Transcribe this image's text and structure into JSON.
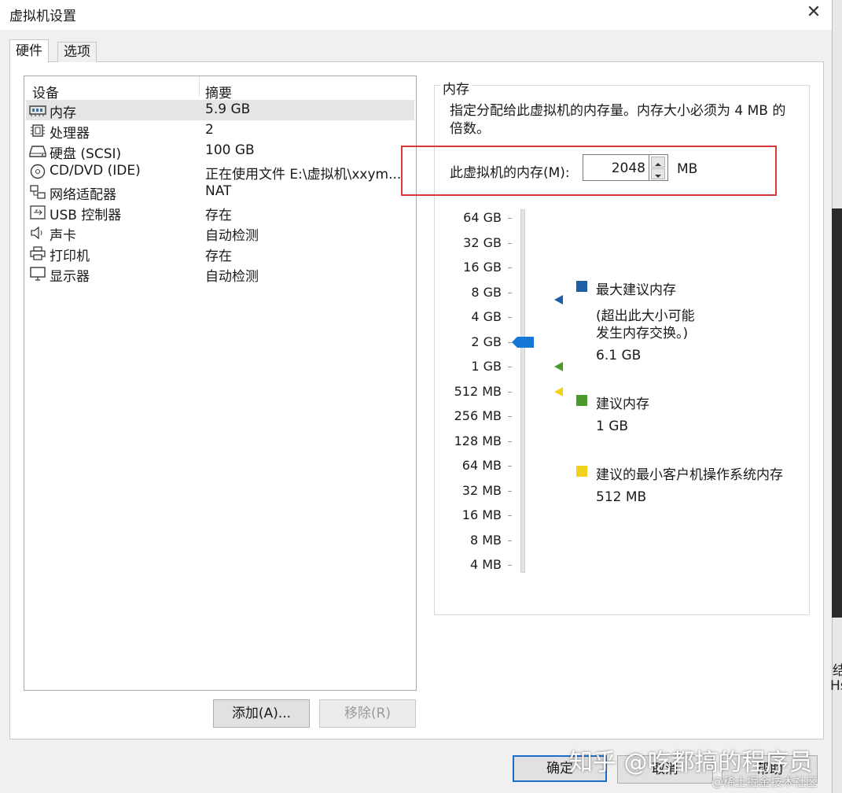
{
  "window": {
    "title": "虚拟机设置",
    "close_glyph": "✕"
  },
  "tabs": [
    {
      "label": "硬件"
    },
    {
      "label": "选项"
    }
  ],
  "device_list": {
    "columns": {
      "device": "设备",
      "summary": "摘要"
    },
    "rows": [
      {
        "name": "内存",
        "summary": "5.9 GB",
        "icon": "memory-icon"
      },
      {
        "name": "处理器",
        "summary": "2",
        "icon": "processor-icon"
      },
      {
        "name": "硬盘 (SCSI)",
        "summary": "100 GB",
        "icon": "hard-disk-icon"
      },
      {
        "name": "CD/DVD (IDE)",
        "summary": "正在使用文件 E:\\虚拟机\\xxym...",
        "icon": "cd-dvd-icon"
      },
      {
        "name": "网络适配器",
        "summary": "NAT",
        "icon": "network-adapter-icon"
      },
      {
        "name": "USB 控制器",
        "summary": "存在",
        "icon": "usb-icon"
      },
      {
        "name": "声卡",
        "summary": "自动检测",
        "icon": "sound-card-icon"
      },
      {
        "name": "打印机",
        "summary": "存在",
        "icon": "printer-icon"
      },
      {
        "name": "显示器",
        "summary": "自动检测",
        "icon": "display-icon"
      }
    ],
    "add_label": "添加(A)...",
    "remove_label": "移除(R)"
  },
  "memory": {
    "group_title": "内存",
    "description": "指定分配给此虚拟机的内存量。内存大小必须为 4 MB 的倍数。",
    "field_label": "此虚拟机的内存(M):",
    "value": "2048",
    "unit": "MB",
    "scale_labels": [
      "64 GB",
      "32 GB",
      "16 GB",
      "8 GB",
      "4 GB",
      "2 GB",
      "1 GB",
      "512 MB",
      "256 MB",
      "128 MB",
      "64 MB",
      "32 MB",
      "16 MB",
      "8 MB",
      "4 MB"
    ],
    "legend": {
      "max": {
        "title": "最大建议内存",
        "note_line1": "(超出此大小可能",
        "note_line2": "发生内存交换。)",
        "value": "6.1 GB",
        "color": "#1a5fa8"
      },
      "recommended": {
        "title": "建议内存",
        "value": "1 GB",
        "color": "#4a9a2a"
      },
      "min_guest": {
        "title": "建议的最小客户机操作系统内存",
        "value": "512 MB",
        "color": "#f2d21b"
      }
    },
    "slider_color": "#1678d6"
  },
  "footer": {
    "ok_label": "确定",
    "cancel_label": "取消",
    "help_label": "帮助"
  },
  "watermark": {
    "main": "知乎 @吃都搞的程序员",
    "sub": "@稀土掘金技术社区"
  },
  "side_strip": {
    "char1": "结",
    "char2": "Hs"
  }
}
